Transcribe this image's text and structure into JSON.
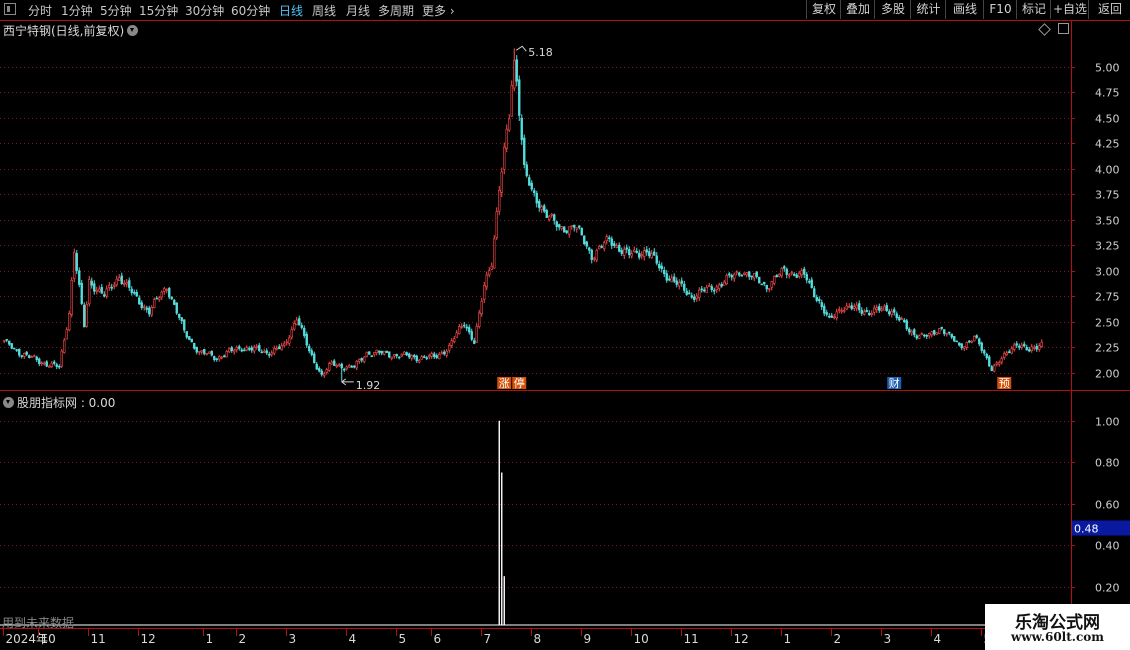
{
  "toolbar": {
    "periods": [
      "分时",
      "1分钟",
      "5分钟",
      "15分钟",
      "30分钟",
      "60分钟",
      "日线",
      "周线",
      "月线",
      "多周期",
      "更多"
    ],
    "active_period": "日线",
    "buttons": [
      "复权",
      "叠加",
      "多股",
      "统计",
      "画线",
      "F10",
      "标记",
      "+自选",
      "返回"
    ]
  },
  "header": {
    "stock_title": "西宁特钢(日线,前复权)",
    "indicator_title": "股朋指标网 : 0.00"
  },
  "footer": {
    "future_data_note": "用到未来数据"
  },
  "watermark": {
    "line1": "乐淘公式网",
    "line2": "www.60lt.com"
  },
  "colors": {
    "up": "#ff4d4d",
    "down": "#55dddd",
    "grid": "#7a1a1a",
    "axis": "#b01010",
    "indicator_line": "#ffffff",
    "highlight_box": "#0a1aa0",
    "limit_up_tag": "#d4500a"
  },
  "chart_data": [
    {
      "type": "candlestick",
      "title": "西宁特钢(日线,前复权)",
      "ylim": [
        1.85,
        5.3
      ],
      "y_ticks": [
        2.0,
        2.25,
        2.5,
        2.75,
        3.0,
        3.25,
        3.5,
        3.75,
        4.0,
        4.25,
        4.5,
        4.75,
        5.0
      ],
      "y_tick_labels": [
        "2.00",
        "2.25",
        "2.50",
        "2.75",
        "3.00",
        "3.25",
        "3.50",
        "3.75",
        "4.00",
        "4.25",
        "4.50",
        "4.75",
        "5.00"
      ],
      "x_month_labels": [
        "2024年",
        "10",
        "11",
        "12",
        "1",
        "2",
        "3",
        "4",
        "5",
        "6",
        "7",
        "8",
        "9",
        "10",
        "11",
        "12",
        "1",
        "2",
        "3",
        "4",
        "5",
        "6"
      ],
      "x_month_index": [
        0,
        14,
        34,
        54,
        80,
        93,
        113,
        137,
        157,
        171,
        191,
        211,
        231,
        251,
        271,
        291,
        311,
        331,
        351,
        371,
        391,
        411
      ],
      "n_days": 426,
      "close_path": [
        [
          0,
          2.3
        ],
        [
          5,
          2.22
        ],
        [
          10,
          2.15
        ],
        [
          18,
          2.08
        ],
        [
          22,
          2.05
        ],
        [
          26,
          2.6
        ],
        [
          28,
          3.2
        ],
        [
          32,
          2.45
        ],
        [
          34,
          2.9
        ],
        [
          40,
          2.75
        ],
        [
          46,
          2.95
        ],
        [
          52,
          2.75
        ],
        [
          58,
          2.6
        ],
        [
          65,
          2.85
        ],
        [
          72,
          2.4
        ],
        [
          78,
          2.2
        ],
        [
          85,
          2.15
        ],
        [
          95,
          2.25
        ],
        [
          105,
          2.2
        ],
        [
          112,
          2.25
        ],
        [
          117,
          2.55
        ],
        [
          122,
          2.2
        ],
        [
          127,
          1.98
        ],
        [
          131,
          2.08
        ],
        [
          140,
          2.05
        ],
        [
          145,
          2.2
        ],
        [
          155,
          2.18
        ],
        [
          165,
          2.15
        ],
        [
          172,
          2.15
        ],
        [
          178,
          2.25
        ],
        [
          184,
          2.5
        ],
        [
          188,
          2.3
        ],
        [
          190,
          2.55
        ],
        [
          192,
          2.85
        ],
        [
          195,
          3.1
        ],
        [
          198,
          3.8
        ],
        [
          202,
          4.5
        ],
        [
          204,
          5.18
        ],
        [
          206,
          4.6
        ],
        [
          208,
          4.0
        ],
        [
          211,
          3.75
        ],
        [
          216,
          3.6
        ],
        [
          222,
          3.4
        ],
        [
          228,
          3.45
        ],
        [
          235,
          3.15
        ],
        [
          242,
          3.3
        ],
        [
          250,
          3.15
        ],
        [
          257,
          3.2
        ],
        [
          263,
          3.0
        ],
        [
          270,
          2.85
        ],
        [
          275,
          2.75
        ],
        [
          285,
          2.85
        ],
        [
          295,
          3.0
        ],
        [
          305,
          2.85
        ],
        [
          312,
          3.0
        ],
        [
          320,
          2.95
        ],
        [
          326,
          2.7
        ],
        [
          330,
          2.5
        ],
        [
          335,
          2.65
        ],
        [
          345,
          2.6
        ],
        [
          355,
          2.62
        ],
        [
          362,
          2.4
        ],
        [
          370,
          2.35
        ],
        [
          375,
          2.45
        ],
        [
          382,
          2.25
        ],
        [
          388,
          2.35
        ],
        [
          395,
          2.05
        ],
        [
          400,
          2.15
        ],
        [
          405,
          2.3
        ],
        [
          410,
          2.2
        ],
        [
          415,
          2.3
        ]
      ],
      "annotations": {
        "high": {
          "label": "5.18",
          "value": 5.18,
          "index": 204
        },
        "low": {
          "label": "1.92",
          "value": 1.92,
          "index": 135
        }
      },
      "event_markers": [
        {
          "label": "涨",
          "index": 200,
          "color": "#d4500a"
        },
        {
          "label": "停",
          "index": 206,
          "color": "#d4500a"
        },
        {
          "label": "财",
          "index": 356,
          "color": "#1e5fb0"
        },
        {
          "label": "预",
          "index": 400,
          "color": "#d4500a"
        }
      ]
    },
    {
      "type": "line",
      "name": "股朋指标网",
      "ylim": [
        0,
        1.1
      ],
      "y_ticks": [
        0.2,
        0.4,
        0.6,
        0.8,
        1.0
      ],
      "y_tick_labels": [
        "0.20",
        "0.40",
        "0.60",
        "0.80",
        "1.00"
      ],
      "current_value_label": "0.48",
      "current_value": 0.48,
      "spikes": [
        {
          "index": 198,
          "value": 1.0
        },
        {
          "index": 199,
          "value": 0.75
        },
        {
          "index": 200,
          "value": 0.25
        }
      ]
    }
  ]
}
